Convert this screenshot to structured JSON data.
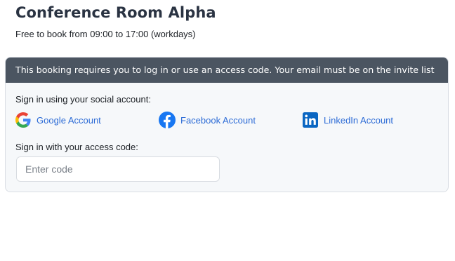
{
  "page": {
    "title": "Conference Room Alpha",
    "availability": "Free to book from 09:00 to 17:00 (workdays)"
  },
  "login_card": {
    "notice": "This booking requires you to log in or use an access code. Your email must be on the invite list",
    "social_label": "Sign in using your social account:",
    "social_accounts": [
      {
        "label": "Google Account",
        "icon": "google-icon"
      },
      {
        "label": "Facebook Account",
        "icon": "facebook-icon",
        "color": "#1877f2"
      },
      {
        "label": "LinkedIn Account",
        "icon": "linkedin-icon",
        "color": "#0a66c2"
      }
    ],
    "code_label": "Sign in with your access code:",
    "code_input": {
      "placeholder": "Enter code",
      "value": ""
    }
  },
  "colors": {
    "header_bg": "#4b5561",
    "link": "#2c6bd6",
    "title": "#2a3342"
  }
}
